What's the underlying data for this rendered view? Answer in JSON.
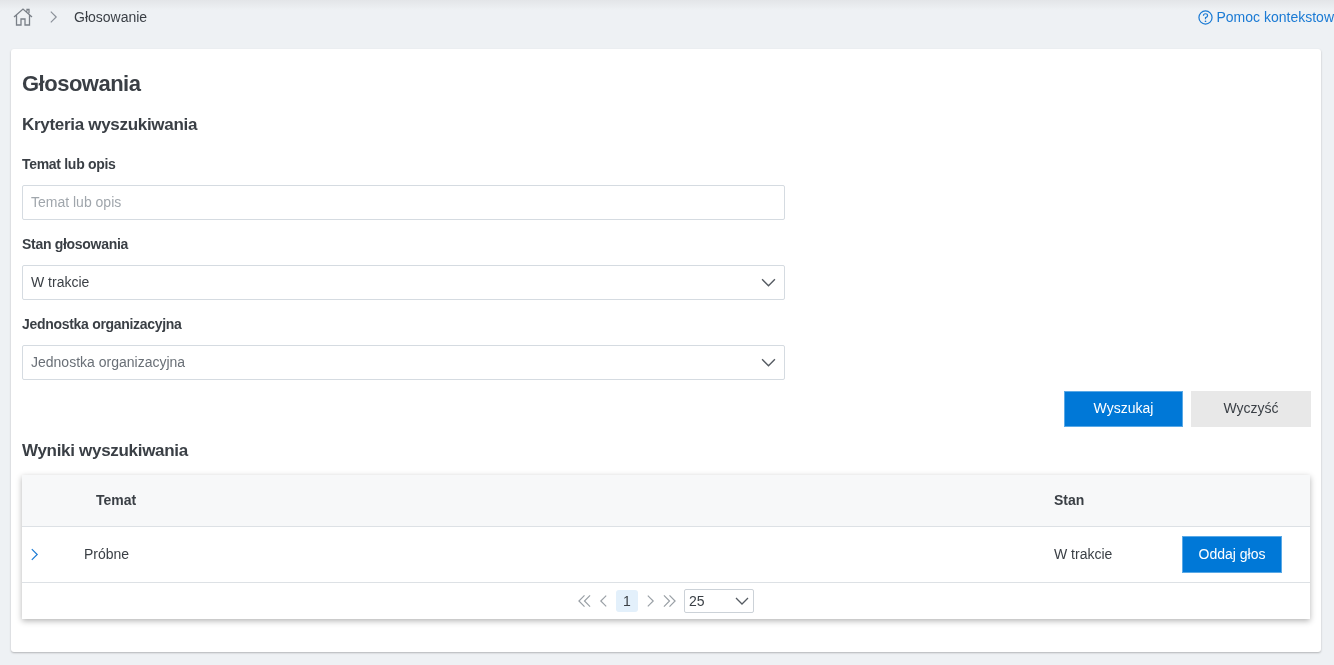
{
  "breadcrumb": {
    "items": [
      {
        "label": "Głosowanie"
      }
    ]
  },
  "help_link": {
    "label": "Pomoc kontekstow"
  },
  "page_title": "Głosowania",
  "search_section": {
    "title": "Kryteria wyszukiwania",
    "fields": [
      {
        "kind": "text",
        "label": "Temat lub opis",
        "placeholder": "Temat lub opis"
      },
      {
        "kind": "select",
        "label": "Stan głosowania",
        "value": "W trakcie"
      },
      {
        "kind": "select",
        "label": "Jednostka organizacyjna",
        "placeholder": "Jednostka organizacyjna"
      }
    ],
    "buttons": [
      {
        "label": "Wyszukaj",
        "kind": "primary"
      },
      {
        "label": "Wyczyść",
        "kind": "secondary"
      }
    ]
  },
  "results_section": {
    "title": "Wyniki wyszukiwania",
    "table": {
      "columns": [
        "Temat",
        "Stan"
      ],
      "rows": [
        {
          "expanded": false,
          "cells": [
            "Próbne",
            "W trakcie"
          ],
          "action": "Oddaj głos"
        }
      ]
    },
    "pagination": {
      "pages": [
        {
          "label": "1",
          "selected": true
        }
      ],
      "page_size": "25"
    }
  }
}
